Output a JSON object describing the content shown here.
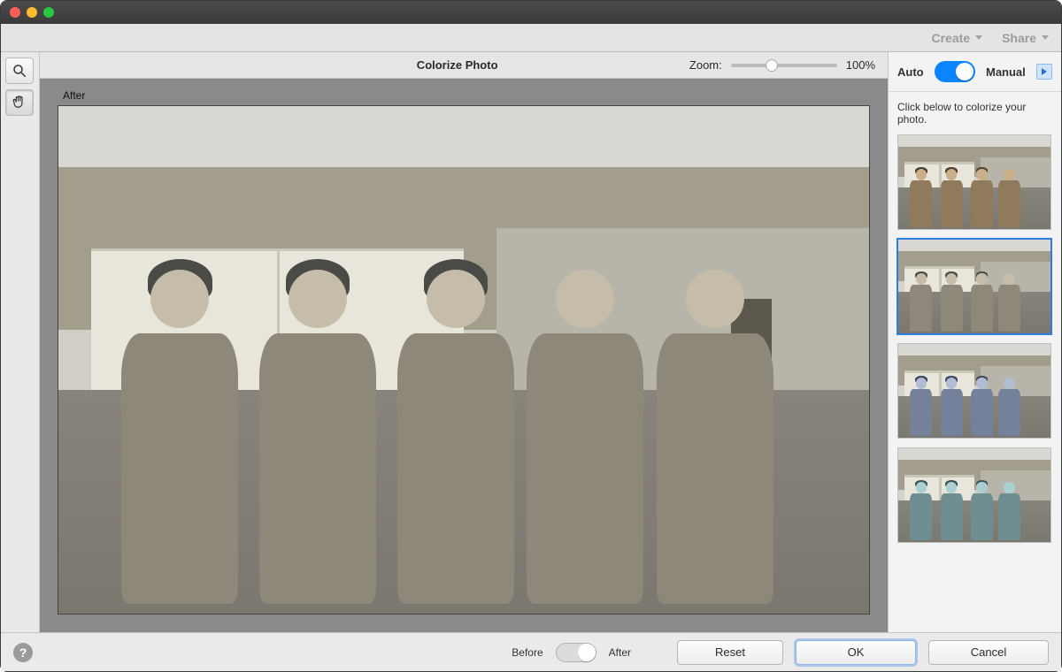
{
  "menubar": {
    "create_label": "Create",
    "share_label": "Share"
  },
  "tools": {
    "zoom_tool_name": "zoom-tool",
    "hand_tool_name": "hand-tool"
  },
  "header": {
    "title": "Colorize Photo",
    "zoom_label": "Zoom:",
    "zoom_percent": "100%",
    "zoom_value": 33
  },
  "canvas": {
    "after_label": "After"
  },
  "side": {
    "auto_label": "Auto",
    "manual_label": "Manual",
    "mode": "auto",
    "hint": "Click below to colorize your photo.",
    "variants": [
      {
        "id": "v-sepia",
        "selected": false
      },
      {
        "id": "v-neutral",
        "selected": true
      },
      {
        "id": "v-cool",
        "selected": false
      },
      {
        "id": "v-teal",
        "selected": false
      }
    ]
  },
  "bottom": {
    "help_glyph": "?",
    "before_label": "Before",
    "after_label": "After",
    "before_after_state": "after",
    "reset_label": "Reset",
    "ok_label": "OK",
    "cancel_label": "Cancel"
  }
}
